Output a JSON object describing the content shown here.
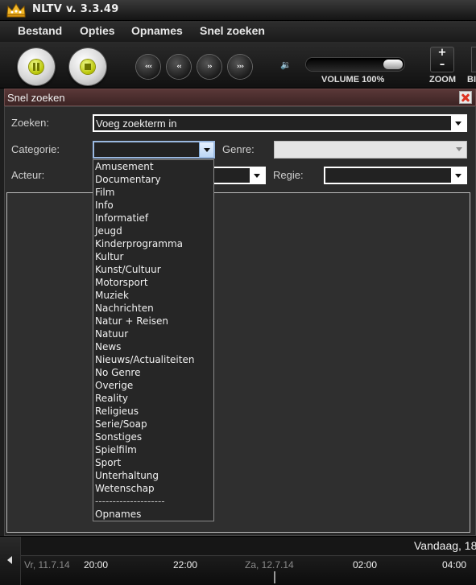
{
  "app": {
    "title": "NLTV v. 3.3.49"
  },
  "menu": {
    "items": [
      "Bestand",
      "Opties",
      "Opnames",
      "Snel zoeken"
    ]
  },
  "toolbar": {
    "pause_icon": "pause-icon",
    "stop_icon": "stop-icon",
    "skip_labels": [
      "‹‹‹",
      "‹‹",
      "››",
      "›››"
    ],
    "volume_icon": "🔉",
    "volume_label": "VOLUME 100%",
    "volume_level": 1.0,
    "zoom_plus": "+",
    "zoom_minus": "–",
    "zoom_label": "ZOOM",
    "extra_label": "BI"
  },
  "panel": {
    "title": "Snel zoeken",
    "search_label": "Zoeken:",
    "search_value": "Voeg zoekterm in",
    "category_label": "Categorie:",
    "category_value": "",
    "genre_label": "Genre:",
    "genre_value": "",
    "actor_label": "Acteur:",
    "actor_value": "",
    "director_label": "Regie:",
    "director_value": ""
  },
  "category_options": [
    "Amusement",
    "Documentary",
    "Film",
    "Info",
    "Informatief",
    "Jeugd",
    "Kinderprogramma",
    "Kultur",
    "Kunst/Cultuur",
    "Motorsport",
    "Muziek",
    "Nachrichten",
    "Natur + Reisen",
    "Natuur",
    "News",
    "Nieuws/Actualiteiten",
    "No Genre",
    "Overige",
    "Reality",
    "Religieus",
    "Serie/Soap",
    "Sonstiges",
    "Spielfilm",
    "Sport",
    "Unterhaltung",
    "Wetenschap"
  ],
  "category_separator": "--------------------",
  "category_extra": "Opnames",
  "timeline": {
    "today_label": "Vandaag, 18",
    "days": [
      "Vr, 11.7.14",
      "Za, 12.7.14"
    ],
    "times": [
      "20:00",
      "22:00",
      "02:00",
      "04:00"
    ]
  },
  "colors": {
    "panel_header": "#4a2e2e",
    "close_red": "#dd3322",
    "button_accent": "#b8c400"
  }
}
